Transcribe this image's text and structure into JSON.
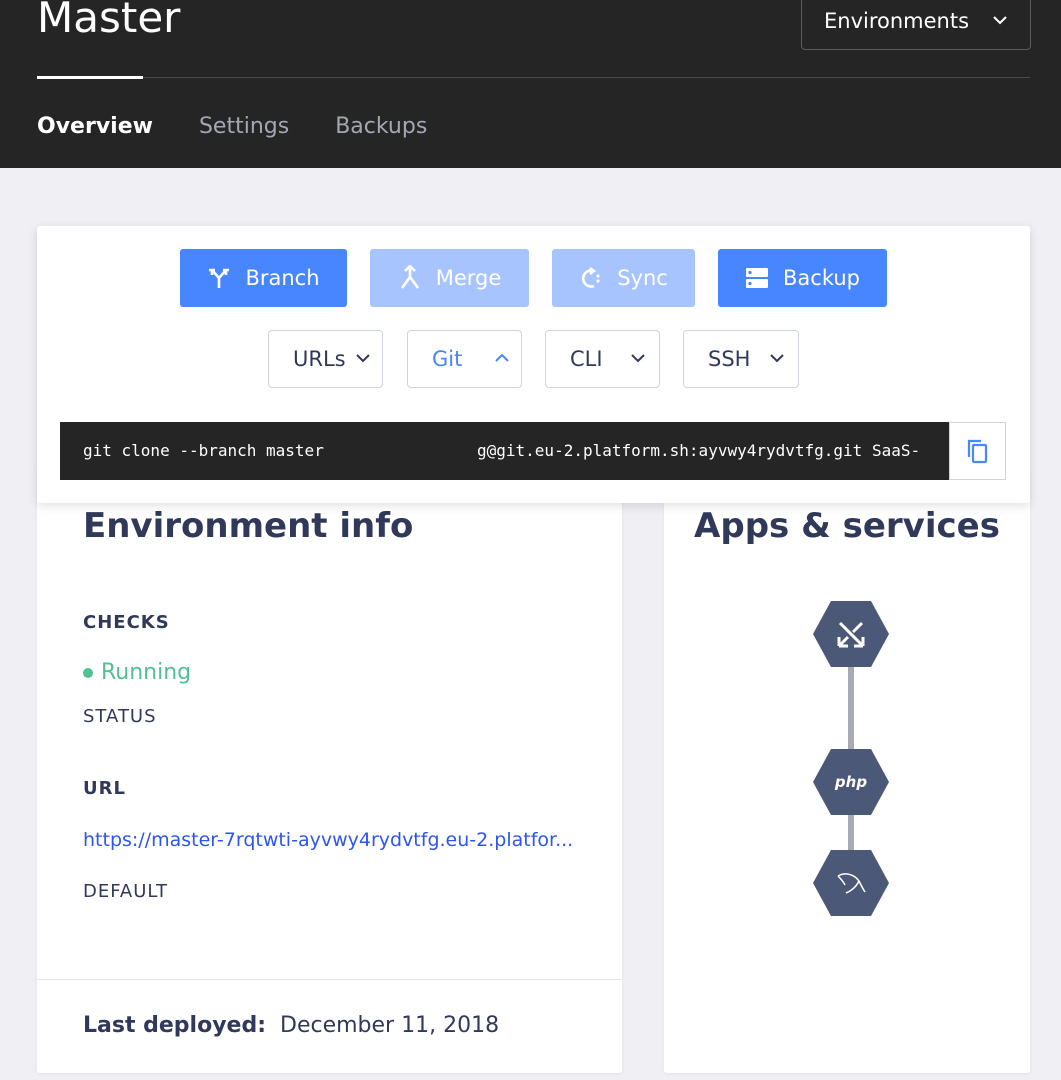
{
  "header": {
    "title": "Master",
    "environments_label": "Environments",
    "tabs": [
      {
        "label": "Overview",
        "active": true
      },
      {
        "label": "Settings",
        "active": false
      },
      {
        "label": "Backups",
        "active": false
      }
    ]
  },
  "actions": {
    "buttons": [
      {
        "label": "Branch",
        "icon": "branch-icon",
        "enabled": true
      },
      {
        "label": "Merge",
        "icon": "merge-icon",
        "enabled": false
      },
      {
        "label": "Sync",
        "icon": "sync-icon",
        "enabled": false
      },
      {
        "label": "Backup",
        "icon": "backup-icon",
        "enabled": true
      }
    ],
    "dropdowns": [
      {
        "label": "URLs",
        "open": false
      },
      {
        "label": "Git",
        "open": true
      },
      {
        "label": "CLI",
        "open": false
      },
      {
        "label": "SSH",
        "open": false
      }
    ],
    "command_start": "git clone --branch master",
    "command_end": "g@git.eu-2.platform.sh:ayvwy4rydvtfg.git SaaS-"
  },
  "env_info": {
    "title": "Environment info",
    "checks_label": "CHECKS",
    "status_value": "Running",
    "status_label": "STATUS",
    "url_label": "URL",
    "url_value": "https://master-7rqtwti-ayvwy4rydvtfg.eu-2.platfor...",
    "url_kind": "DEFAULT",
    "last_deployed_label": "Last deployed:",
    "last_deployed_value": "December 11, 2018"
  },
  "apps": {
    "title": "Apps & services",
    "nodes": [
      {
        "name": "router",
        "icon": "router-icon"
      },
      {
        "name": "php",
        "label": "php",
        "icon": "php-icon"
      },
      {
        "name": "mysql",
        "icon": "mysql-dolphin-icon"
      }
    ]
  },
  "colors": {
    "header_bg": "#252526",
    "accent": "#4786ff",
    "accent_disabled": "#a7c4ff",
    "running": "#4fc193",
    "link": "#2d55ef",
    "node": "#4c5877"
  }
}
